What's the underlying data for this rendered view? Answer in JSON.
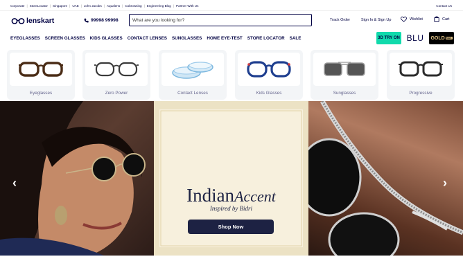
{
  "topbar": {
    "links": [
      "Corporate",
      "StoreLocator",
      "Singapore",
      "UAE",
      "John Jacobs",
      "Aqualens",
      "Cobrowsing",
      "Engineering Blog",
      "Partner With Us"
    ],
    "contact": "Contact Us"
  },
  "header": {
    "logo_text": "lenskart",
    "phone": "99998 99998",
    "search_placeholder": "What are you looking for?",
    "track_order": "Track Order",
    "signin": "Sign In & Sign Up",
    "wishlist": "Wishlist",
    "cart": "Cart"
  },
  "nav": {
    "items": [
      "EYEGLASSES",
      "SCREEN GLASSES",
      "KIDS GLASSES",
      "CONTACT LENSES",
      "SUNGLASSES",
      "HOME EYE-TEST",
      "STORE LOCATOR",
      "SALE"
    ],
    "try_on": "3D TRY ON",
    "blu": "BLU",
    "gold": "GOLD"
  },
  "categories": [
    "Eyeglasses",
    "Zero Power",
    "Contact Lenses",
    "Kids Glasses",
    "Sunglasses",
    "Progressive"
  ],
  "banner": {
    "title_main": "Indian",
    "title_script": "Accent",
    "subtitle": "Inspired by Bidri",
    "cta": "Shop Now",
    "prev": "‹",
    "next": "›"
  },
  "colors": {
    "navy": "#000042",
    "teal": "#11daac",
    "button": "#1d2243"
  }
}
